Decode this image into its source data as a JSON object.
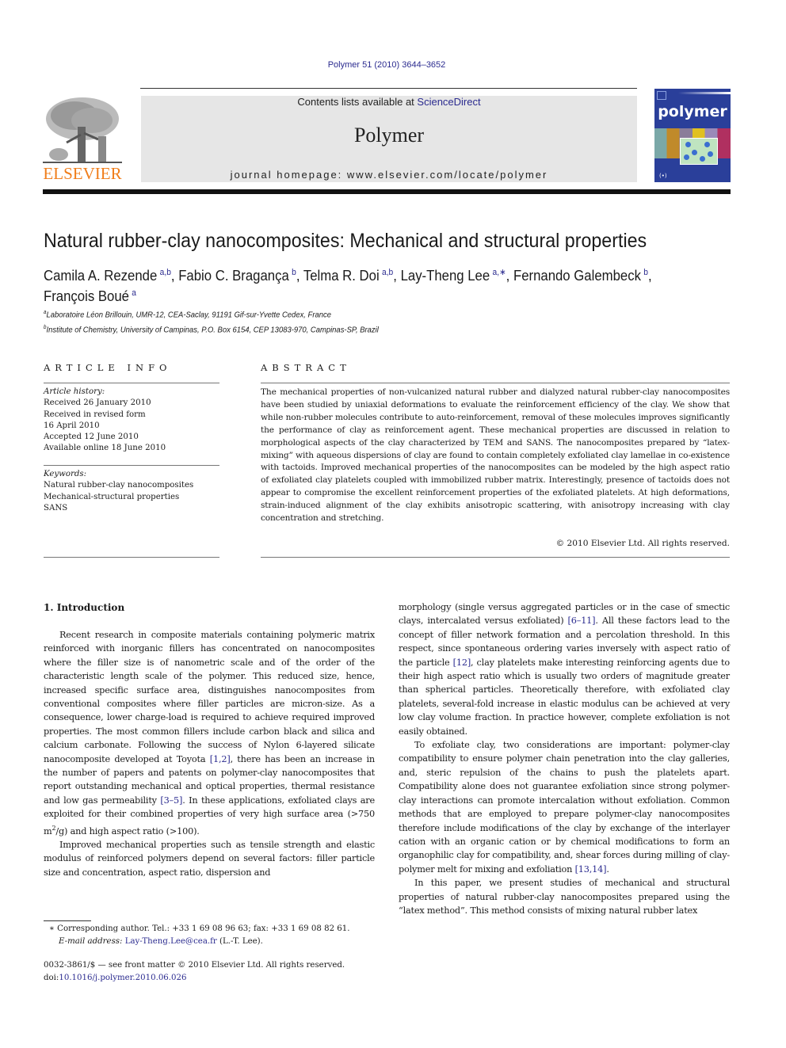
{
  "header": {
    "citation": "Polymer 51 (2010) 3644–3652",
    "publisher_logo": "ELSEVIER",
    "contents_prefix": "Contents lists available at ",
    "contents_link": "ScienceDirect",
    "journal_name": "Polymer",
    "homepage": "journal homepage: www.elsevier.com/locate/polymer",
    "cover_title": "polymer",
    "colors": {
      "link": "#2b2b8f",
      "elsevier_orange": "#f07d1a",
      "box_gray": "#e6e6e6",
      "cover_blue": "#2a3f9a"
    }
  },
  "article": {
    "title": "Natural rubber-clay nanocomposites: Mechanical and structural properties",
    "authors": [
      {
        "name": "Camila A. Rezende",
        "sup": "a,b",
        "sep": ", "
      },
      {
        "name": "Fabio C. Bragança",
        "sup": "b",
        "sep": ", "
      },
      {
        "name": "Telma R. Doi",
        "sup": "a,b",
        "sep": ", "
      },
      {
        "name": "Lay-Theng Lee",
        "sup": "a,∗",
        "sep": ", "
      },
      {
        "name": "Fernando Galembeck",
        "sup": "b",
        "sep": ", "
      },
      {
        "name": "François Boué",
        "sup": "a",
        "sep": ""
      }
    ],
    "affiliations": [
      {
        "key": "a",
        "text": "Laboratoire Léon Brillouin, UMR-12, CEA-Saclay, 91191 Gif-sur-Yvette Cedex, France"
      },
      {
        "key": "b",
        "text": "Institute of Chemistry, University of Campinas, P.O. Box 6154, CEP 13083-970, Campinas-SP, Brazil"
      }
    ]
  },
  "article_info": {
    "heading": "ARTICLE INFO",
    "history_label": "Article history:",
    "history": [
      "Received 26 January 2010",
      "Received in revised form",
      "16 April 2010",
      "Accepted 12 June 2010",
      "Available online 18 June 2010"
    ],
    "keywords_label": "Keywords:",
    "keywords": [
      "Natural rubber-clay nanocomposites",
      "Mechanical-structural properties",
      "SANS"
    ]
  },
  "abstract": {
    "heading": "ABSTRACT",
    "text": "The mechanical properties of non-vulcanized natural rubber and dialyzed natural rubber-clay nanocomposites have been studied by uniaxial deformations to evaluate the reinforcement efficiency of the clay. We show that while non-rubber molecules contribute to auto-reinforcement, removal of these molecules improves significantly the performance of clay as reinforcement agent. These mechanical properties are discussed in relation to morphological aspects of the clay characterized by TEM and SANS. The nanocomposites prepared by “latex-mixing” with aqueous dispersions of clay are found to contain completely exfoliated clay lamellae in co-existence with tactoids. Improved mechanical properties of the nanocomposites can be modeled by the high aspect ratio of exfoliated clay platelets coupled with immobilized rubber matrix. Interestingly, presence of tactoids does not appear to compromise the excellent reinforcement properties of the exfoliated platelets. At high deformations, strain-induced alignment of the clay exhibits anisotropic scattering, with anisotropy increasing with clay concentration and stretching.",
    "copyright": "© 2010 Elsevier Ltd. All rights reserved."
  },
  "introduction": {
    "heading": "1.  Introduction",
    "left_p1": [
      "Recent research in composite materials containing polymeric matrix reinforced with inorganic fillers has concentrated on nanocomposites where the filler size is of nanometric scale and of the order of the characteristic length scale of the polymer. This reduced size, hence, increased specific surface area, distinguishes nanocomposites from conventional composites where filler particles are micron-size. As a consequence, lower charge-load is required to achieve required improved properties. The most common fillers include carbon black and silica and calcium carbonate. Following the success of Nylon 6-layered silicate nanocomposite developed at Toyota ",
      "[1,2]",
      ", there has been an increase in the number of papers and patents on polymer-clay nanocomposites that report outstanding mechanical and optical properties, thermal resistance and low gas permeability ",
      "[3–5]",
      ". In these applications, exfoliated clays are exploited for their combined properties of very high surface area (>750 m",
      "2",
      "/g) and high aspect ratio (>100)."
    ],
    "left_p2": "Improved mechanical properties such as tensile strength and elastic modulus of reinforced polymers depend on several factors: filler particle size and concentration, aspect ratio, dispersion and",
    "right_p1": [
      "morphology (single versus aggregated particles or in the case of smectic clays, intercalated versus exfoliated) ",
      "[6–11]",
      ". All these factors lead to the concept of filler network formation and a percolation threshold. In this respect, since spontaneous ordering varies inversely with aspect ratio of the particle ",
      "[12]",
      ", clay platelets make interesting reinforcing agents due to their high aspect ratio which is usually two orders of magnitude greater than spherical particles. Theoretically therefore, with exfoliated clay platelets, several-fold increase in elastic modulus can be achieved at very low clay volume fraction. In practice however, complete exfoliation is not easily obtained."
    ],
    "right_p2": [
      "To exfoliate clay, two considerations are important: polymer-clay compatibility to ensure polymer chain penetration into the clay galleries, and, steric repulsion of the chains to push the platelets apart. Compatibility alone does not guarantee exfoliation since strong polymer-clay interactions can promote intercalation without exfoliation. Common methods that are employed to prepare polymer-clay nanocomposites therefore include modifications of the clay by exchange of the interlayer cation with an organic cation or by chemical modifications to form an organophilic clay for compatibility, and, shear forces during milling of clay-polymer melt for mixing and exfoliation ",
      "[13,14]",
      "."
    ],
    "right_p3": "In this paper, we present studies of mechanical and structural properties of natural rubber-clay nanocomposites prepared using the “latex method”. This method consists of mixing natural rubber latex"
  },
  "footnote": {
    "marker": "∗",
    "corresponding": " Corresponding author. Tel.: +33 1 69 08 96 63; fax: +33 1 69 08 82 61.",
    "email_label": "E-mail address: ",
    "email": "Lay-Theng.Lee@cea.fr",
    "email_suffix": " (L.-T. Lee)."
  },
  "front_matter": {
    "issn_line": "0032-3861/$ — see front matter © 2010 Elsevier Ltd. All rights reserved.",
    "doi_prefix": "doi:",
    "doi": "10.1016/j.polymer.2010.06.026"
  }
}
